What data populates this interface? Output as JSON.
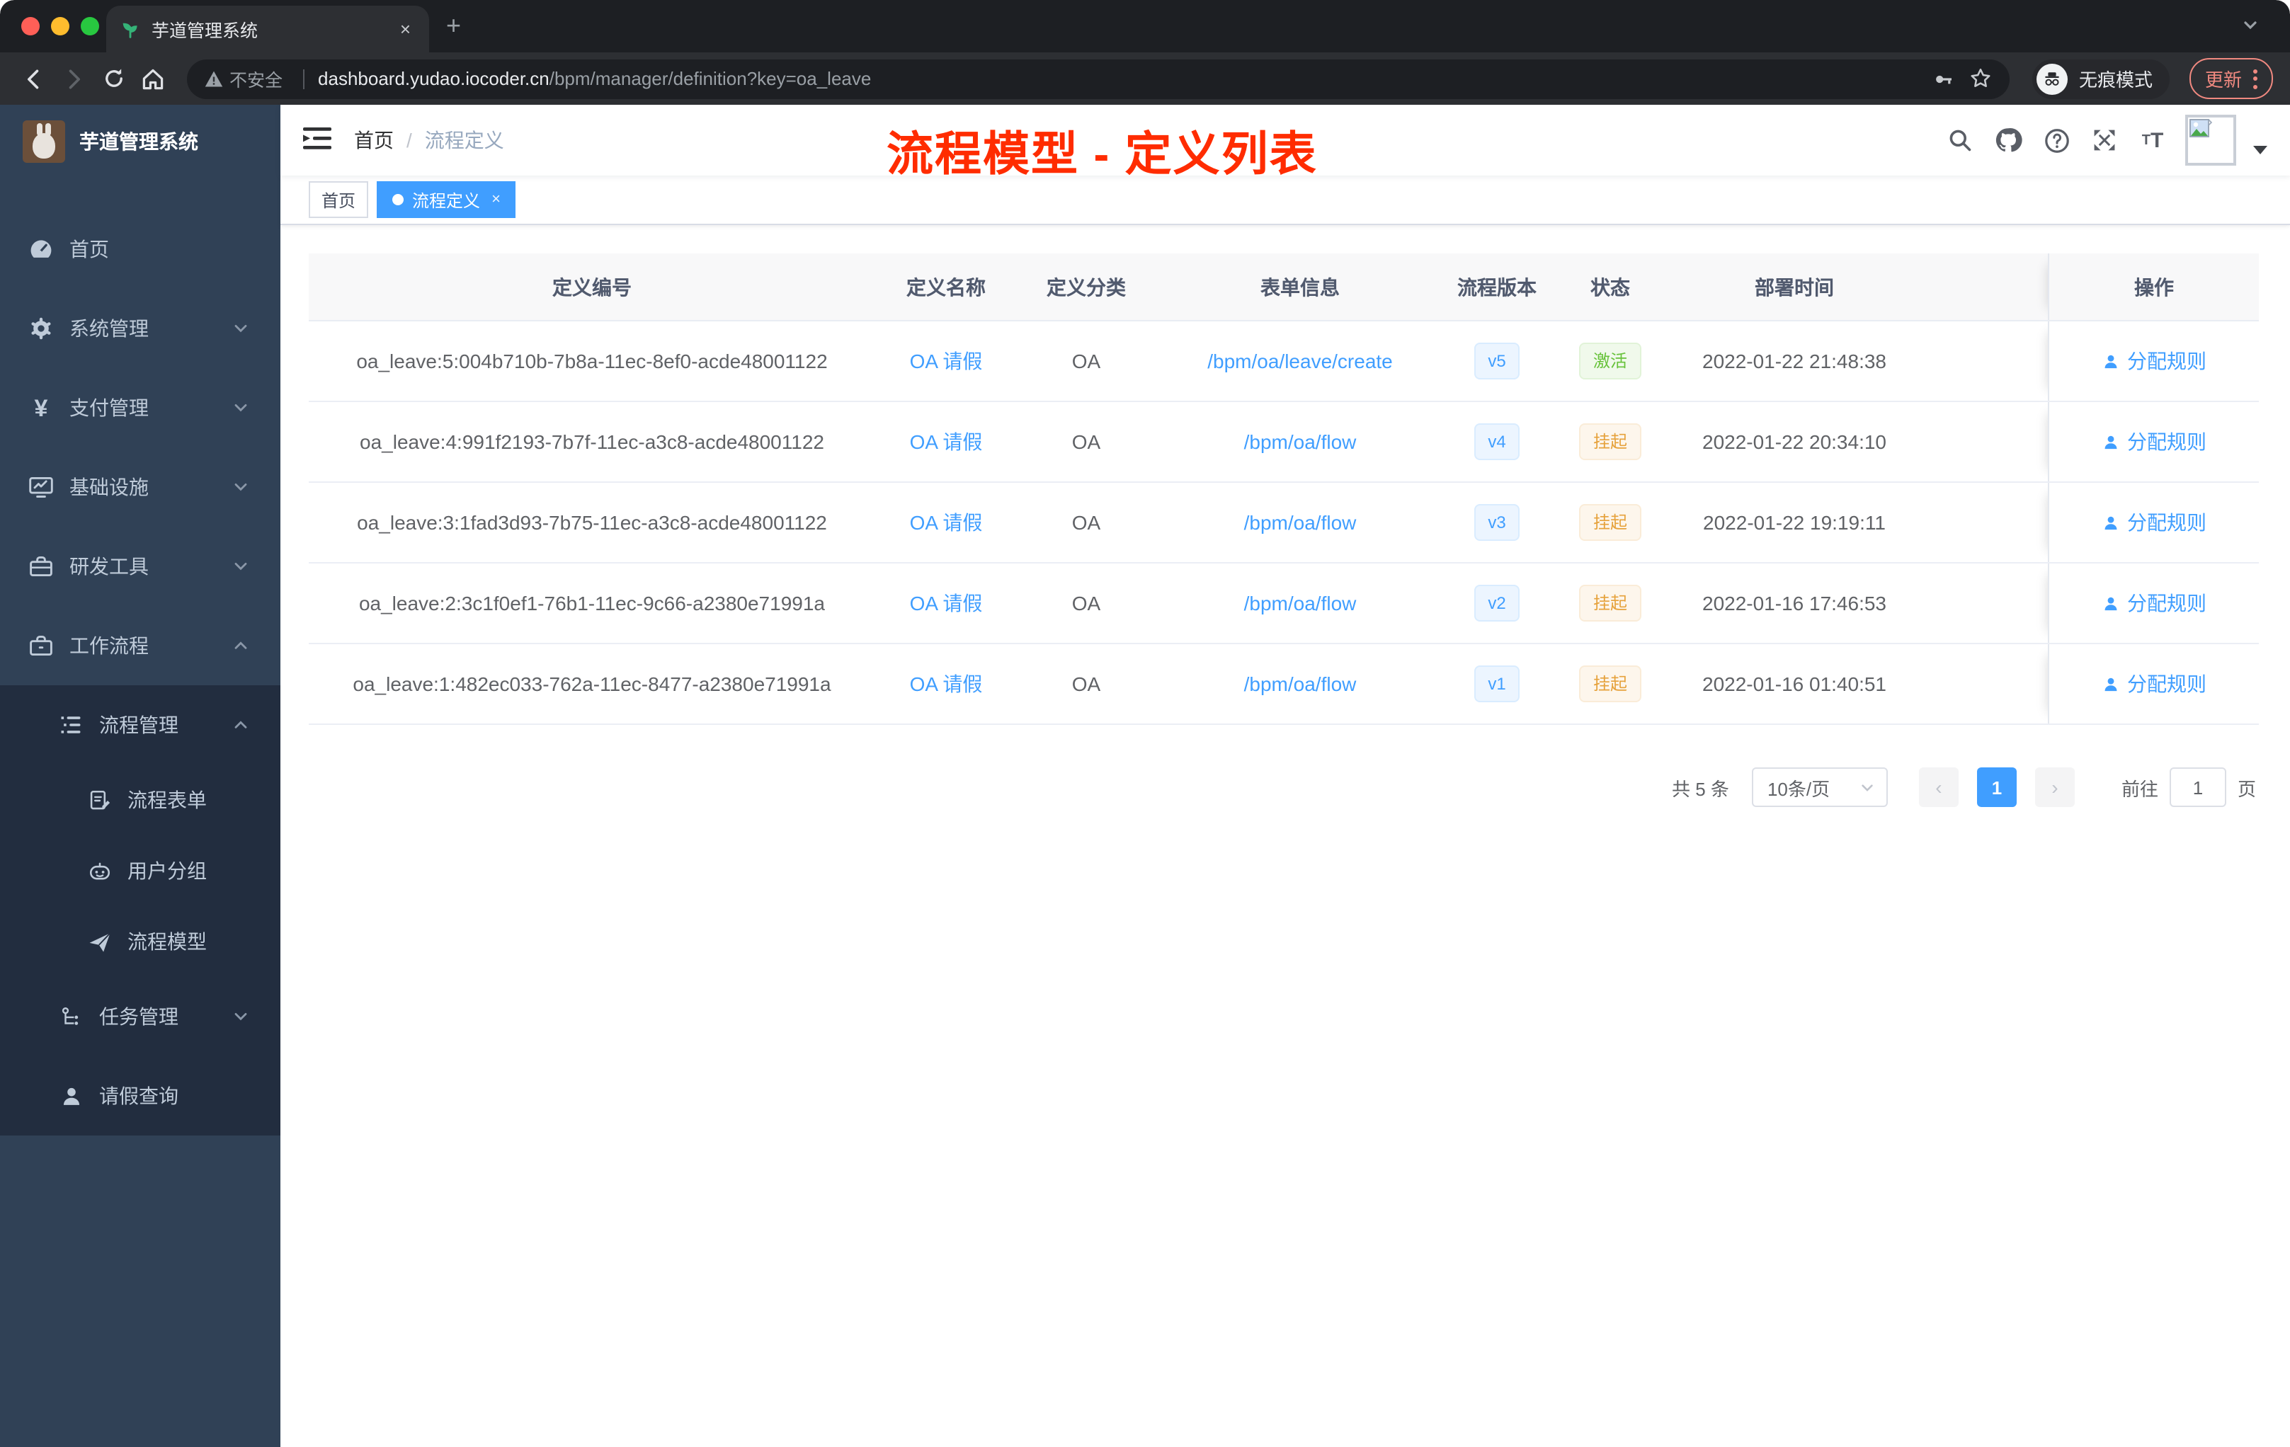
{
  "browser": {
    "tab": {
      "title": "芋道管理系统",
      "close": "×",
      "favicon": "sprout-icon"
    },
    "new_tab": "+",
    "toolbar": {
      "security_label": "不安全",
      "url_host": "dashboard.yudao.iocoder.cn",
      "url_path": "/bpm/manager/definition?key=oa_leave",
      "incognito_label": "无痕模式",
      "update_label": "更新"
    }
  },
  "sidebar": {
    "app_title": "芋道管理系统",
    "items": [
      {
        "label": "首页",
        "icon": "dashboard-icon"
      },
      {
        "label": "系统管理",
        "icon": "gear-icon",
        "chevron": "down"
      },
      {
        "label": "支付管理",
        "icon": "yen-icon",
        "chevron": "down"
      },
      {
        "label": "基础设施",
        "icon": "monitor-icon",
        "chevron": "down"
      },
      {
        "label": "研发工具",
        "icon": "toolbox-icon",
        "chevron": "down"
      },
      {
        "label": "工作流程",
        "icon": "briefcase-icon",
        "chevron": "up"
      },
      {
        "label": "流程管理",
        "icon": "category-icon",
        "chevron": "up"
      },
      {
        "label": "流程表单",
        "icon": "form-icon"
      },
      {
        "label": "用户分组",
        "icon": "robot-icon"
      },
      {
        "label": "流程模型",
        "icon": "paper-plane-icon"
      },
      {
        "label": "任务管理",
        "icon": "tree-icon",
        "chevron": "down"
      },
      {
        "label": "请假查询",
        "icon": "person-icon"
      }
    ]
  },
  "navbar": {
    "breadcrumb": {
      "home": "首页",
      "separator": "/",
      "current": "流程定义"
    },
    "overlay_title": "流程模型 - 定义列表",
    "icons": [
      "search-icon",
      "github-icon",
      "help-icon",
      "fullscreen-icon",
      "font-size-icon",
      "avatar-broken-image",
      "caret-down-icon"
    ]
  },
  "tags_view": {
    "tags": [
      {
        "label": "首页",
        "active": false
      },
      {
        "label": "流程定义",
        "active": true,
        "close": "×"
      }
    ]
  },
  "table": {
    "columns": [
      "定义编号",
      "定义名称",
      "定义分类",
      "表单信息",
      "流程版本",
      "状态",
      "部署时间",
      "操作"
    ],
    "rows": [
      {
        "id": "oa_leave:5:004b710b-7b8a-11ec-8ef0-acde48001122",
        "name": "OA 请假",
        "category": "OA",
        "form": "/bpm/oa/leave/create",
        "version": "v5",
        "status": "激活",
        "time": "2022-01-22 21:48:38",
        "action": "分配规则"
      },
      {
        "id": "oa_leave:4:991f2193-7b7f-11ec-a3c8-acde48001122",
        "name": "OA 请假",
        "category": "OA",
        "form": "/bpm/oa/flow",
        "version": "v4",
        "status": "挂起",
        "time": "2022-01-22 20:34:10",
        "action": "分配规则"
      },
      {
        "id": "oa_leave:3:1fad3d93-7b75-11ec-a3c8-acde48001122",
        "name": "OA 请假",
        "category": "OA",
        "form": "/bpm/oa/flow",
        "version": "v3",
        "status": "挂起",
        "time": "2022-01-22 19:19:11",
        "action": "分配规则"
      },
      {
        "id": "oa_leave:2:3c1f0ef1-76b1-11ec-9c66-a2380e71991a",
        "name": "OA 请假",
        "category": "OA",
        "form": "/bpm/oa/flow",
        "version": "v2",
        "status": "挂起",
        "time": "2022-01-16 17:46:53",
        "action": "分配规则"
      },
      {
        "id": "oa_leave:1:482ec033-762a-11ec-8477-a2380e71991a",
        "name": "OA 请假",
        "category": "OA",
        "form": "/bpm/oa/flow",
        "version": "v1",
        "status": "挂起",
        "time": "2022-01-16 01:40:51",
        "action": "分配规则"
      }
    ]
  },
  "pagination": {
    "total": "共 5 条",
    "page_size": "10条/页",
    "prev": "‹",
    "page": "1",
    "next": "›",
    "goto_label": "前往",
    "goto_value": "1",
    "goto_unit": "页"
  },
  "colors": {
    "accent": "#409eff",
    "overlay_title": "#ff2c00",
    "sidebar_bg": "#304156",
    "sidebar_submenu_bg": "#222d3f",
    "status_active": "#67c23a",
    "status_suspended": "#e6a23c",
    "tag_active_bg": "#409eff",
    "version_badge": "#409eff"
  }
}
